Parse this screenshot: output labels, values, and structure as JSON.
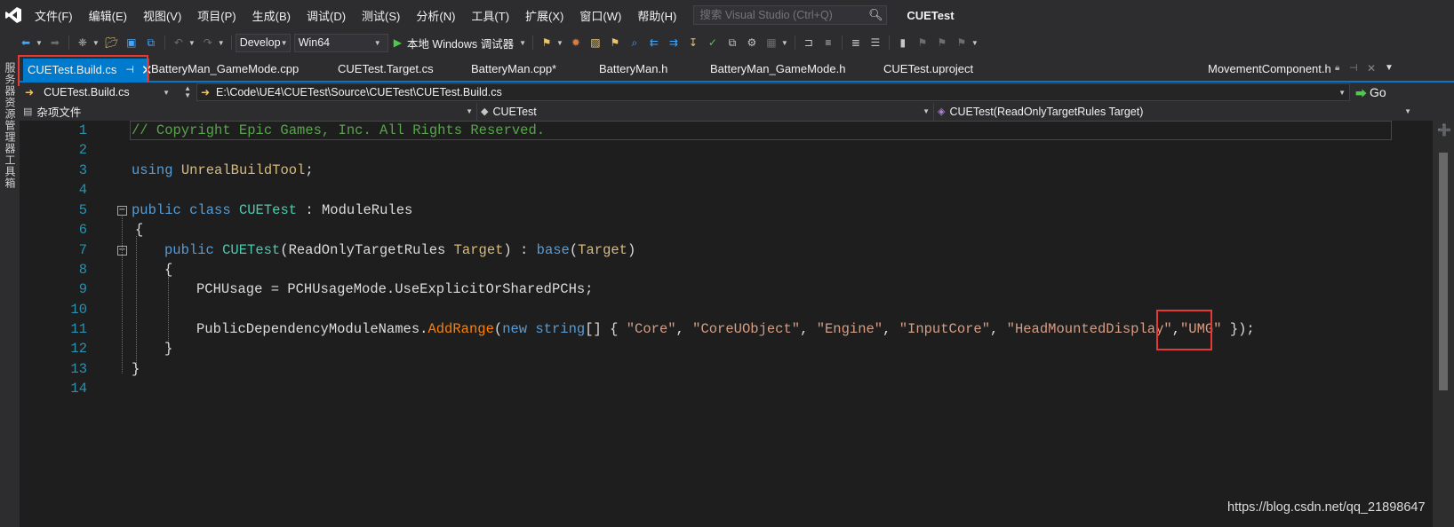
{
  "menubar": {
    "items": [
      "文件(F)",
      "编辑(E)",
      "视图(V)",
      "项目(P)",
      "生成(B)",
      "调试(D)",
      "测试(S)",
      "分析(N)",
      "工具(T)",
      "扩展(X)",
      "窗口(W)",
      "帮助(H)"
    ],
    "search_placeholder": "搜索 Visual Studio (Ctrl+Q)",
    "solution_name": "CUETest"
  },
  "toolbar": {
    "config": "Develop",
    "platform": "Win64",
    "run_label": "本地 Windows 调试器"
  },
  "sidebar": {
    "labels": [
      "服务器资源管理器",
      "工具箱"
    ]
  },
  "tabs": {
    "active": "CUETest.Build.cs",
    "others": [
      "BatteryMan_GameMode.cpp",
      "CUETest.Target.cs",
      "BatteryMan.cpp*",
      "BatteryMan.h",
      "BatteryMan_GameMode.h",
      "CUETest.uproject",
      "MovementComponent.h"
    ]
  },
  "nav": {
    "file_combo": "CUETest.Build.cs",
    "path": "E:\\Code\\UE4\\CUETest\\Source\\CUETest\\CUETest.Build.cs",
    "go_label": "Go",
    "project_combo": "杂项文件",
    "class_combo": "CUETest",
    "member_combo": "CUETest(ReadOnlyTargetRules Target)"
  },
  "editor": {
    "line_numbers": [
      "1",
      "2",
      "3",
      "4",
      "5",
      "6",
      "7",
      "8",
      "9",
      "10",
      "11",
      "12",
      "13",
      "14"
    ],
    "line1": "// Copyright Epic Games, Inc. All Rights Reserved.",
    "line3": {
      "kw": "using",
      "ns": "UnrealBuildTool",
      "end": ";"
    },
    "line5": {
      "kw1": "public",
      "kw2": "class",
      "cls": "CUETest",
      "sep": " : ",
      "base": "ModuleRules"
    },
    "line6": "{",
    "line7": {
      "kw": "public",
      "cls": "CUETest",
      "p1": "(",
      "ptype": "ReadOnlyTargetRules",
      "pname": "Target",
      "p2": ") : ",
      "base": "base",
      "p3": "(",
      "arg": "Target",
      "p4": ")"
    },
    "line8": "{",
    "line9": "PCHUsage = PCHUsageMode.UseExplicitOrSharedPCHs;",
    "line11": {
      "prefix": "PublicDependencyModuleNames.",
      "method": "AddRange",
      "p1": "(",
      "kw_new": "new",
      "kw_string": "string",
      "p2": "[] { ",
      "strings": [
        "\"Core\"",
        "\"CoreUObject\"",
        "\"Engine\"",
        "\"InputCore\"",
        "\"HeadMountedDisplay\""
      ],
      "last_string": "\"UMG\"",
      "end": " });"
    },
    "line12": "}",
    "line13": "}"
  },
  "watermark": "https://blog.csdn.net/qq_21898647",
  "colors": {
    "accent": "#007acc",
    "highlight_box": "#e53935",
    "comment": "#57a64a",
    "keyword": "#569cd6",
    "string": "#d69d85",
    "class": "#4ec9b0",
    "method": "#ff8000"
  }
}
